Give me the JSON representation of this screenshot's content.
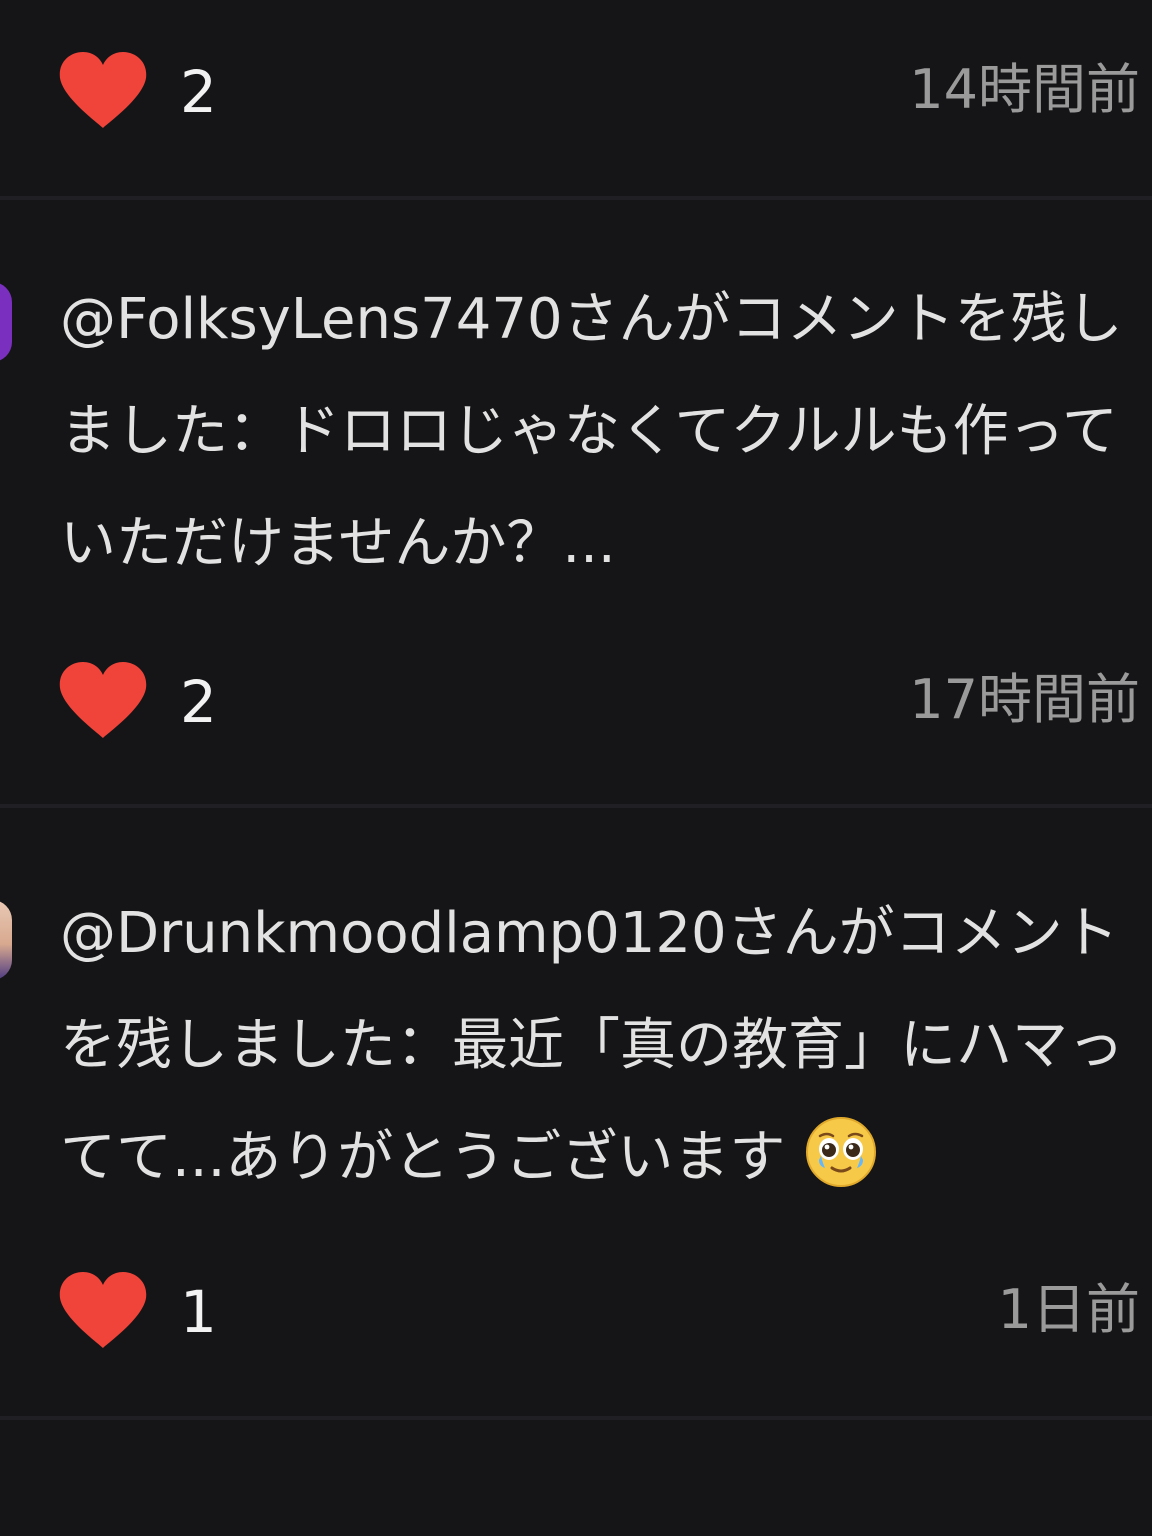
{
  "colors": {
    "background": "#151517",
    "divider": "#202024",
    "heart": "#f0443a",
    "text_primary": "#e2e2e2",
    "text_secondary": "#9a9a9a"
  },
  "items": [
    {
      "likes": "2",
      "time": "14時間前",
      "icon": "heart-icon"
    },
    {
      "avatar_icon": "avatar-edge",
      "comment": "@FolksyLens7470さんがコメントを残しました：ドロロじゃなくてクルルも作っていただけませんか？...",
      "likes": "2",
      "time": "17時間前",
      "icon": "heart-icon"
    },
    {
      "avatar_icon": "avatar-edge",
      "comment": "@Drunkmoodlamp0120さんがコメントを残しました：最近「真の教育」にハマってて...ありがとうございます",
      "emoji": "pleading-face-emoji",
      "likes": "1",
      "time": "1日前",
      "icon": "heart-icon"
    }
  ]
}
